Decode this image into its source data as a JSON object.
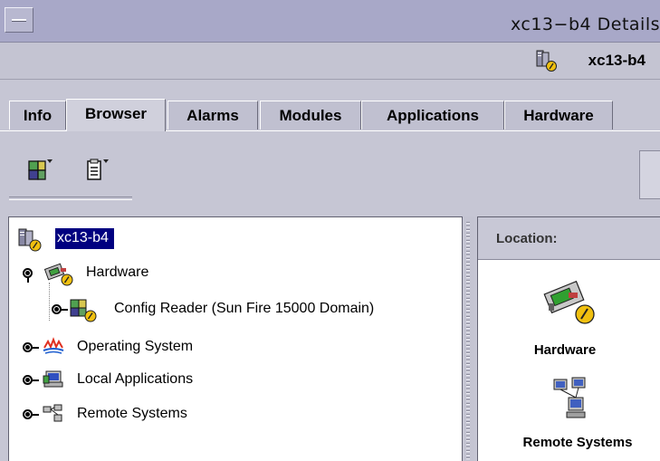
{
  "window": {
    "title": "xc13−b4 Details",
    "host_label": "xc13-b4"
  },
  "tabs": [
    {
      "label": "Info"
    },
    {
      "label": "Browser",
      "active": true
    },
    {
      "label": "Alarms"
    },
    {
      "label": "Modules"
    },
    {
      "label": "Applications"
    },
    {
      "label": "Hardware"
    }
  ],
  "toolbar": {
    "icons": [
      "create-topology-object-icon",
      "view-properties-icon"
    ]
  },
  "tree": {
    "root": {
      "label": "xc13-b4",
      "icon": "host-icon",
      "selected": true
    },
    "items": [
      {
        "label": "Hardware",
        "icon": "hardware-icon",
        "expanded": true
      },
      {
        "label": "Config Reader (Sun Fire 15000 Domain)",
        "icon": "config-reader-icon",
        "child": true
      },
      {
        "label": "Operating System",
        "icon": "operating-system-icon"
      },
      {
        "label": "Local Applications",
        "icon": "local-applications-icon"
      },
      {
        "label": "Remote Systems",
        "icon": "remote-systems-icon"
      }
    ]
  },
  "detail_panel": {
    "location_label": "Location:",
    "items": [
      {
        "label": "Hardware",
        "icon": "hardware-icon"
      },
      {
        "label": "Remote Systems",
        "icon": "remote-systems-icon"
      }
    ]
  },
  "colors": {
    "selection_bg": "#000080",
    "selection_fg": "#ffffff",
    "window_bg": "#c6c6d4",
    "titlebar_bg": "#a8a8c8",
    "alarm_badge": "#f0c010"
  }
}
